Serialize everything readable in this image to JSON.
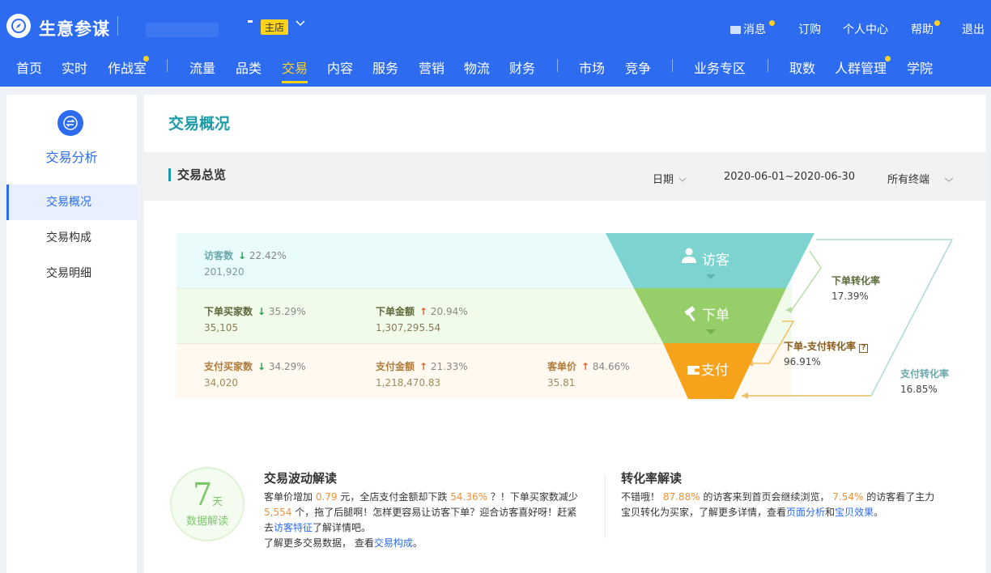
{
  "header": {
    "app_title": "生意参谋",
    "store_badge": "主店",
    "top_links": {
      "messages": "消息",
      "subscribe": "订购",
      "personal": "个人中心",
      "help": "帮助",
      "logout": "退出"
    },
    "nav": {
      "home": "首页",
      "realtime": "实时",
      "warroom": "作战室",
      "traffic": "流量",
      "category": "品类",
      "trade": "交易",
      "content": "内容",
      "service": "服务",
      "marketing": "营销",
      "logistics": "物流",
      "finance": "财务",
      "market": "市场",
      "competition": "竞争",
      "business_zone": "业务专区",
      "data_fetch": "取数",
      "crowd": "人群管理",
      "academy": "学院"
    }
  },
  "sidebar": {
    "title": "交易分析",
    "items": [
      "交易概况",
      "交易构成",
      "交易明细"
    ]
  },
  "main": {
    "page_title": "交易概况",
    "summary_title": "交易总览",
    "date_label": "日期",
    "date_range": "2020-06-01~2020-06-30",
    "terminal": "所有终端",
    "metrics": {
      "visitors": {
        "label": "访客数",
        "change": "22.42%",
        "value": "201,920"
      },
      "order_buyers": {
        "label": "下单买家数",
        "change": "35.29%",
        "value": "35,105"
      },
      "order_amount": {
        "label": "下单金额",
        "change": "20.94%",
        "value": "1,307,295.54"
      },
      "pay_buyers": {
        "label": "支付买家数",
        "change": "34.29%",
        "value": "34,020"
      },
      "pay_amount": {
        "label": "支付金额",
        "change": "21.33%",
        "value": "1,218,470.83"
      },
      "unit_price": {
        "label": "客单价",
        "change": "84.66%",
        "value": "35.81"
      }
    },
    "funnel": {
      "visitor": "访客",
      "order": "下单",
      "pay": "支付"
    },
    "rates": {
      "order_rate": {
        "label": "下单转化率",
        "value": "17.39%"
      },
      "order_pay_rate": {
        "label": "下单-支付转化率",
        "value": "96.91%"
      },
      "pay_rate": {
        "label": "支付转化率",
        "value": "16.85%"
      }
    },
    "badge": {
      "num": "7",
      "unit": "天",
      "sub": "数据解读"
    },
    "volatility": {
      "title": "交易波动解读",
      "t1": "客单价增加",
      "v1": "0.79",
      "t2": "元，全店支付金额却下跌",
      "v2": "54.36%",
      "t3": "？！下单买家数减少",
      "v3": "5,554",
      "t4": "个，拖了后腿啊！怎样更容易让访客下单？迎合访客喜好呀！赶紧",
      "t5": "去",
      "link1": "访客特征",
      "t6": "了解详情吧。",
      "t7": "了解更多交易数据，  查看",
      "link2": "交易构成",
      "t8": "。"
    },
    "conversion": {
      "title": "转化率解读",
      "t1": "不错哦！",
      "v1": "87.88%",
      "t2": "的访客来到首页会继续浏览，",
      "v2": "7.54%",
      "t3": "的访客看了主力",
      "t4": "宝贝转化为买家，了解更多详情，查看",
      "link1": "页面分析",
      "t5": "和",
      "link2": "宝贝效果",
      "t6": "。"
    }
  }
}
